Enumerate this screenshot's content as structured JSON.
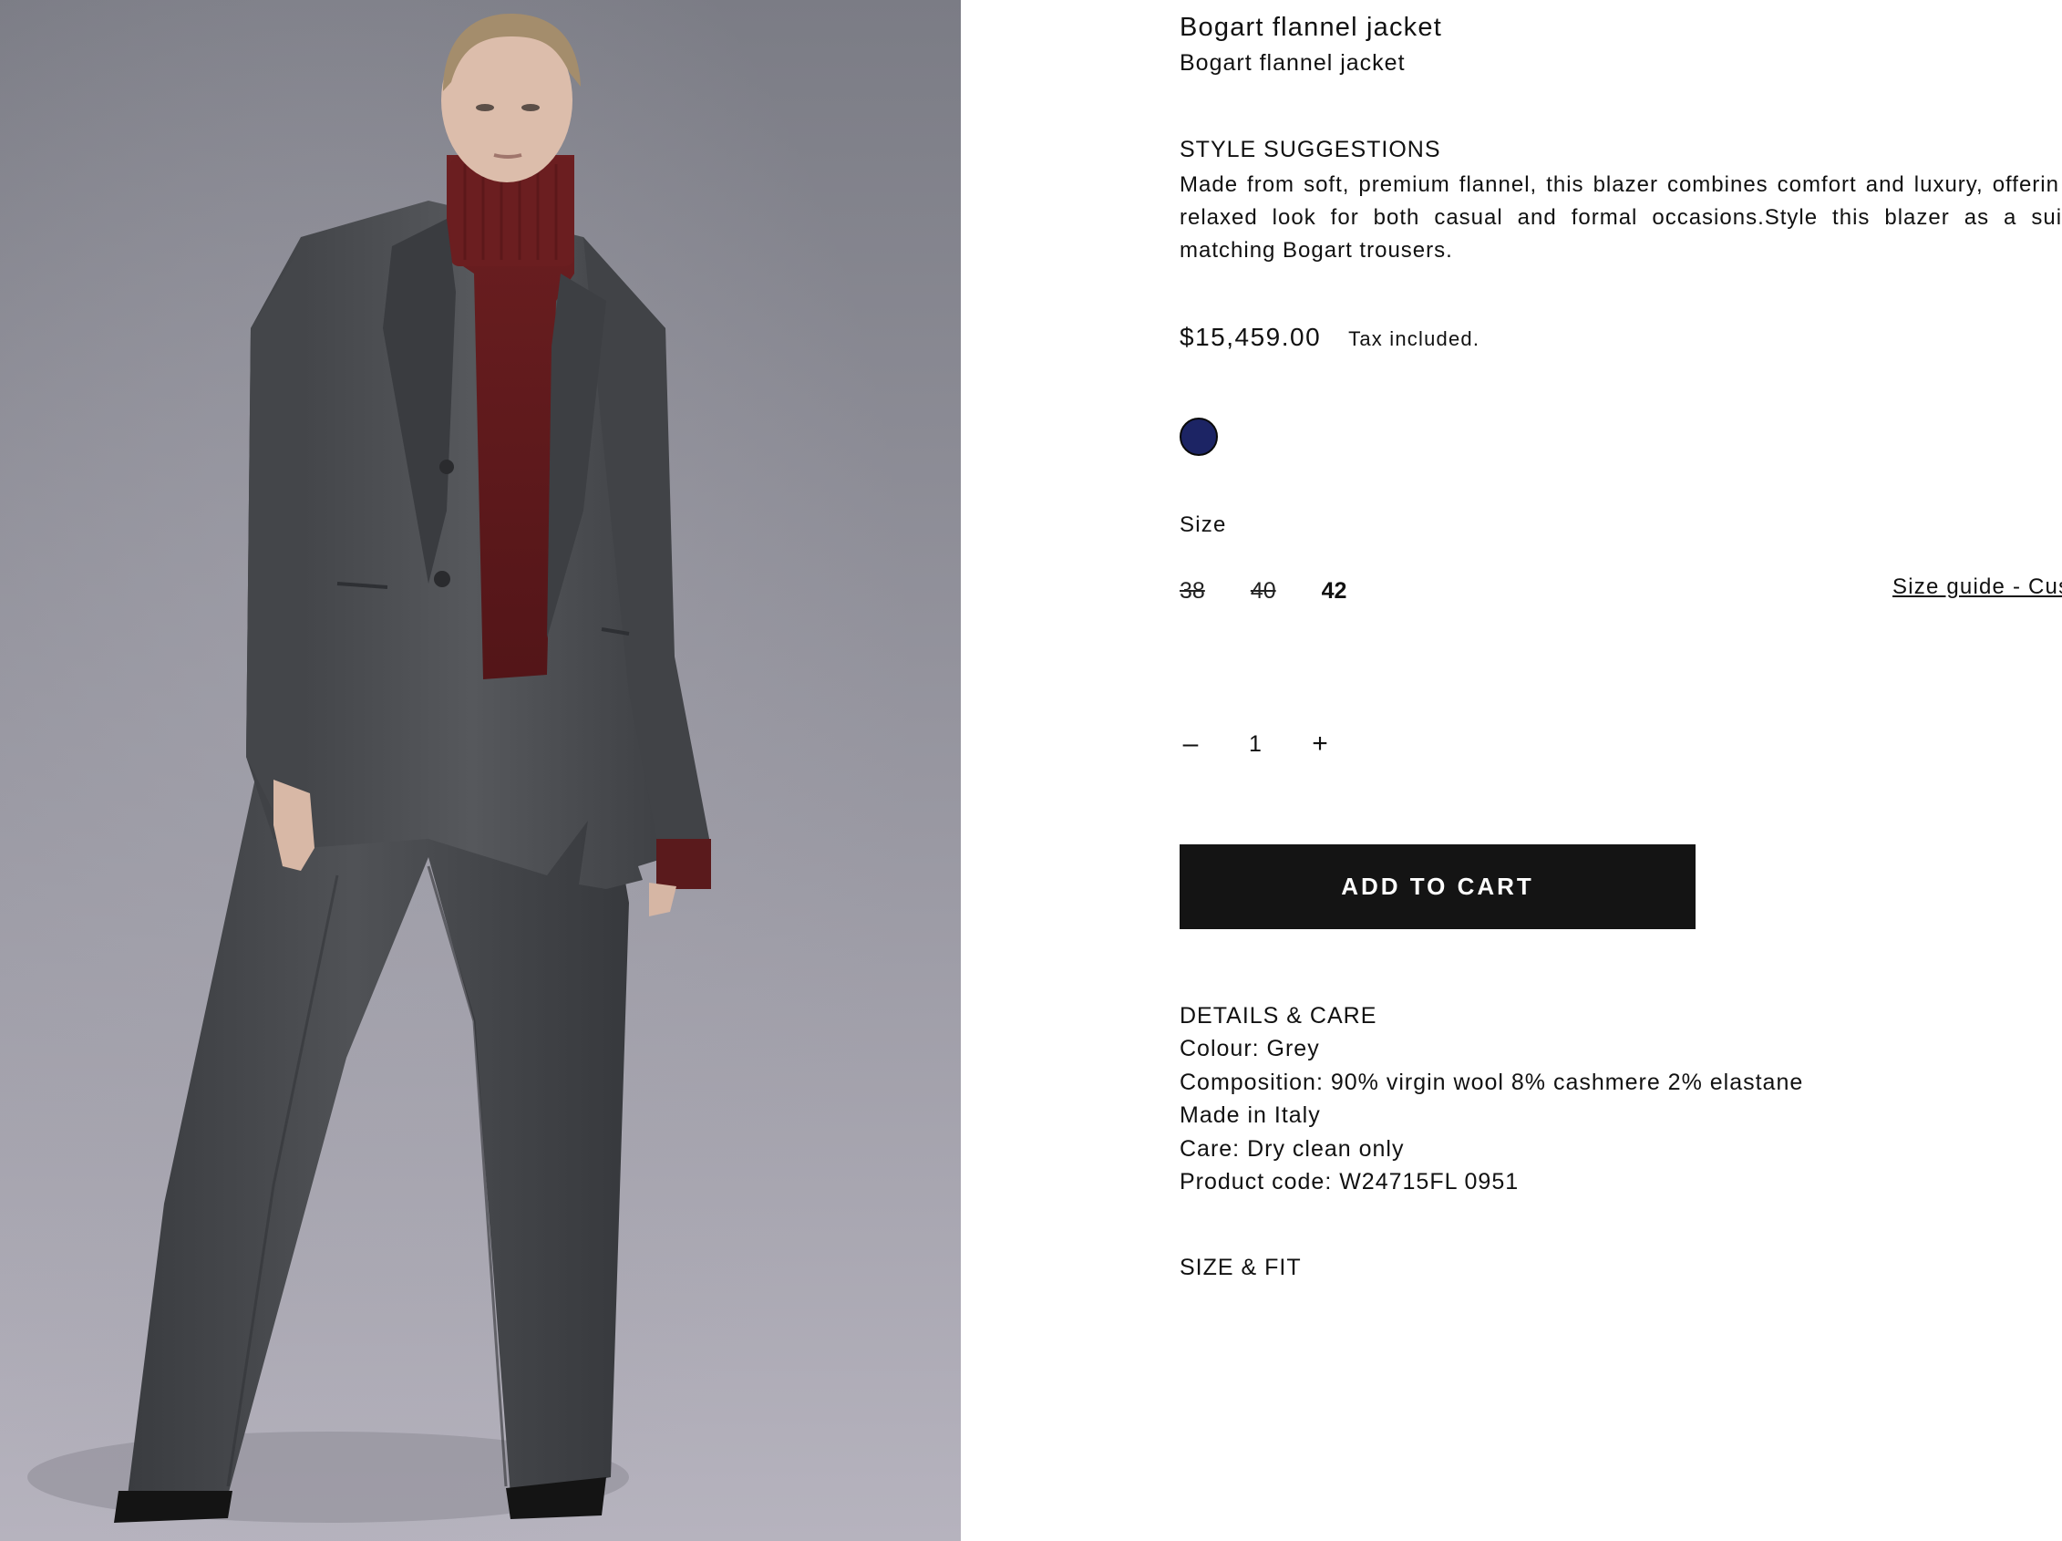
{
  "product": {
    "title": "Bogart flannel jacket",
    "subtitle": "Bogart flannel jacket",
    "image_alt": "Model wearing grey flannel blazer, burgundy turtleneck and wide-leg grey trousers"
  },
  "style_suggestions": {
    "heading": "STYLE SUGGESTIONS",
    "text": "Made from soft, premium flannel, this blazer combines comfort and luxury, offerin yet relaxed look for both casual and formal occasions.Style this blazer as a suit w matching Bogart trousers."
  },
  "pricing": {
    "price": "$15,459.00",
    "tax_note": "Tax included."
  },
  "colour_swatch": {
    "color": "#1c2464",
    "name": "navy-swatch"
  },
  "size": {
    "label": "Size",
    "options": [
      {
        "label": "38",
        "available": false
      },
      {
        "label": "40",
        "available": false
      },
      {
        "label": "42",
        "available": true
      }
    ],
    "guide_link": "Size guide - Cus"
  },
  "quantity": {
    "decrement": "–",
    "value": "1",
    "increment": "+"
  },
  "cart": {
    "button_label": "ADD TO CART"
  },
  "details": {
    "heading": "DETAILS & CARE",
    "lines": [
      "Colour: Grey",
      "Composition: 90% virgin wool 8% cashmere 2% elastane",
      "Made in Italy",
      "Care: Dry clean only",
      "Product code: W24715FL 0951"
    ]
  },
  "size_fit": {
    "heading": "SIZE & FIT"
  },
  "colors": {
    "backdrop_top": "#7c7d86",
    "backdrop_bottom": "#b3b1bc",
    "suit_grey": "#4b4d51",
    "sweater_burgundy": "#6a1d1f",
    "button_black": "#141414"
  }
}
